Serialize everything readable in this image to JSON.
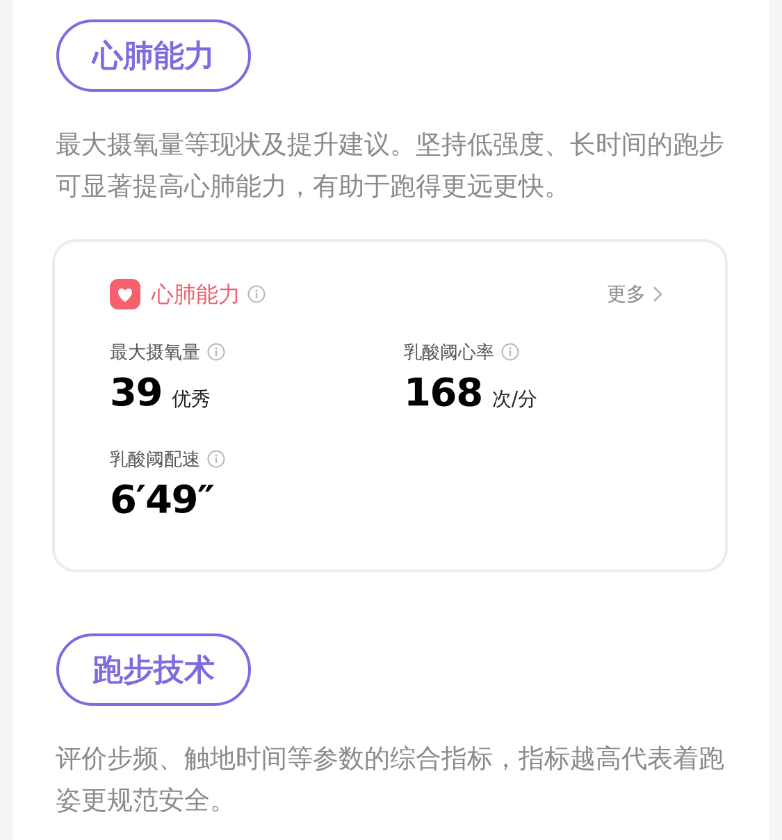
{
  "sections": [
    {
      "badge": "心肺能力",
      "description": "最大摄氧量等现状及提升建议。坚持低强度、长时间的跑步可显著提高心肺能力，有助于跑得更远更快。",
      "card": {
        "title": "心肺能力",
        "more": "更多",
        "metrics": [
          {
            "label": "最大摄氧量",
            "value": "39",
            "unit": "优秀"
          },
          {
            "label": "乳酸阈心率",
            "value": "168",
            "unit": "次/分"
          },
          {
            "label": "乳酸阈配速",
            "value": "6′49″"
          }
        ]
      }
    },
    {
      "badge": "跑步技术",
      "description": "评价步频、触地时间等参数的综合指标，指标越高代表着跑姿更规范安全。"
    }
  ]
}
